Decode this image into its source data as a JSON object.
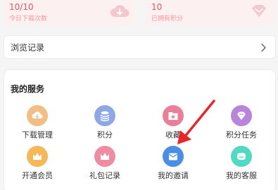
{
  "stats": {
    "downloads": {
      "value": "10/10",
      "label": "今日下载次数",
      "icon": "download-cloud-icon"
    },
    "points": {
      "value": "10",
      "label": "已拥有积分",
      "icon": "diamond-icon"
    }
  },
  "browse_history": {
    "label": "浏览记录",
    "icon": "chevron-right-icon"
  },
  "services": {
    "title": "我的服务",
    "items": [
      {
        "label": "下载管理",
        "icon": "download-icon",
        "color": "#f2be86"
      },
      {
        "label": "积分",
        "icon": "coins-icon",
        "color": "#8ea8e6"
      },
      {
        "label": "收藏",
        "icon": "star-folder-icon",
        "color": "#ea7f99"
      },
      {
        "label": "积分任务",
        "icon": "diamond-icon",
        "color": "#b985dc"
      },
      {
        "label": "开通会员",
        "icon": "crown-icon",
        "color": "#f5b75a"
      },
      {
        "label": "礼包记录",
        "icon": "gift-icon",
        "color": "#ee8da0"
      },
      {
        "label": "我的邀请",
        "icon": "mail-icon",
        "color": "#4c8ee3"
      },
      {
        "label": "我的客服",
        "icon": "customer-service-icon",
        "color": "#52d9c3"
      }
    ]
  },
  "colors": {
    "accent": "#e05a63",
    "annotation_arrow": "#e8262a"
  }
}
